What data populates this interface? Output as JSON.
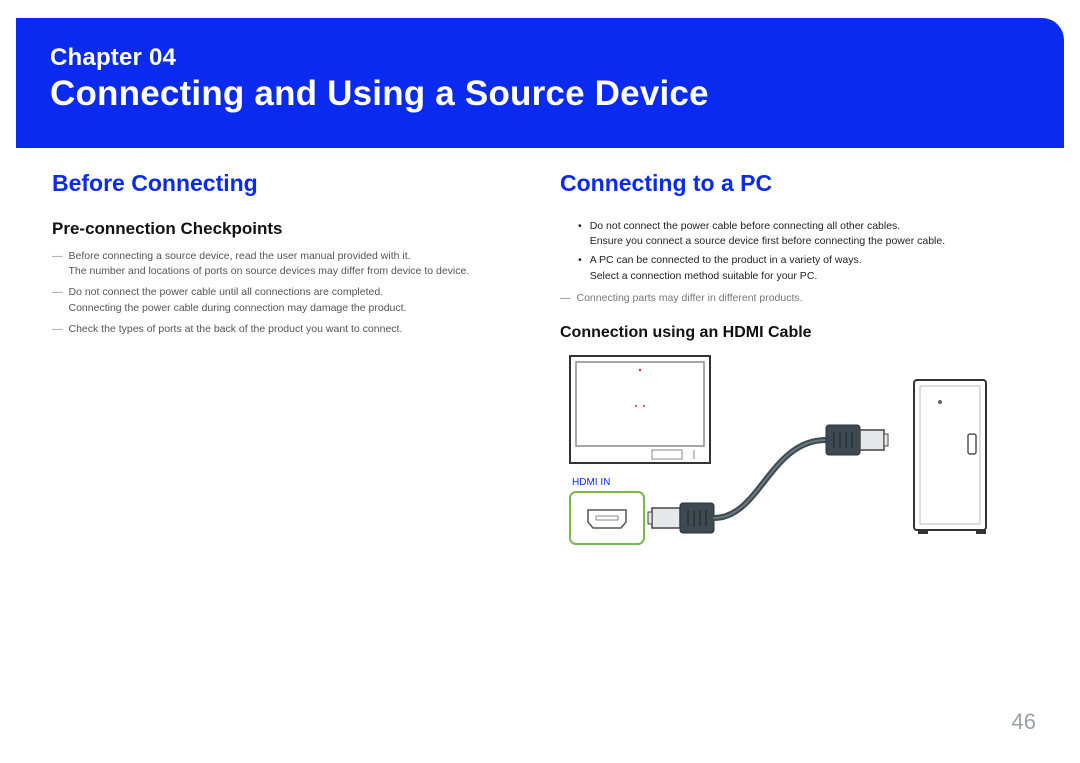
{
  "banner": {
    "chapter_label": "Chapter  04",
    "title": "Connecting and Using a Source Device"
  },
  "left": {
    "section_title": "Before Connecting",
    "subhead": "Pre-connection Checkpoints",
    "items": [
      {
        "l1": "Before connecting a source device, read the user manual provided with it.",
        "l2": "The number and locations of ports on source devices may differ from device to device."
      },
      {
        "l1": "Do not connect the power cable until all connections are completed.",
        "l2": "Connecting the power cable during connection may damage the product."
      },
      {
        "l1": "Check the types of ports at the back of the product you want to connect.",
        "l2": ""
      }
    ]
  },
  "right": {
    "section_title": "Connecting to a PC",
    "bullets": [
      {
        "l1": "Do not connect the power cable before connecting all other cables.",
        "l2": "Ensure you connect a source device first before connecting the power cable."
      },
      {
        "l1": "A PC can be connected to the product in a variety of ways.",
        "l2": "Select a connection method suitable for your PC."
      }
    ],
    "note": "Connecting parts may differ in different products.",
    "subhead2": "Connection using an HDMI Cable",
    "diagram": {
      "hdmi_label": "HDMI IN"
    }
  },
  "page_number": "46"
}
